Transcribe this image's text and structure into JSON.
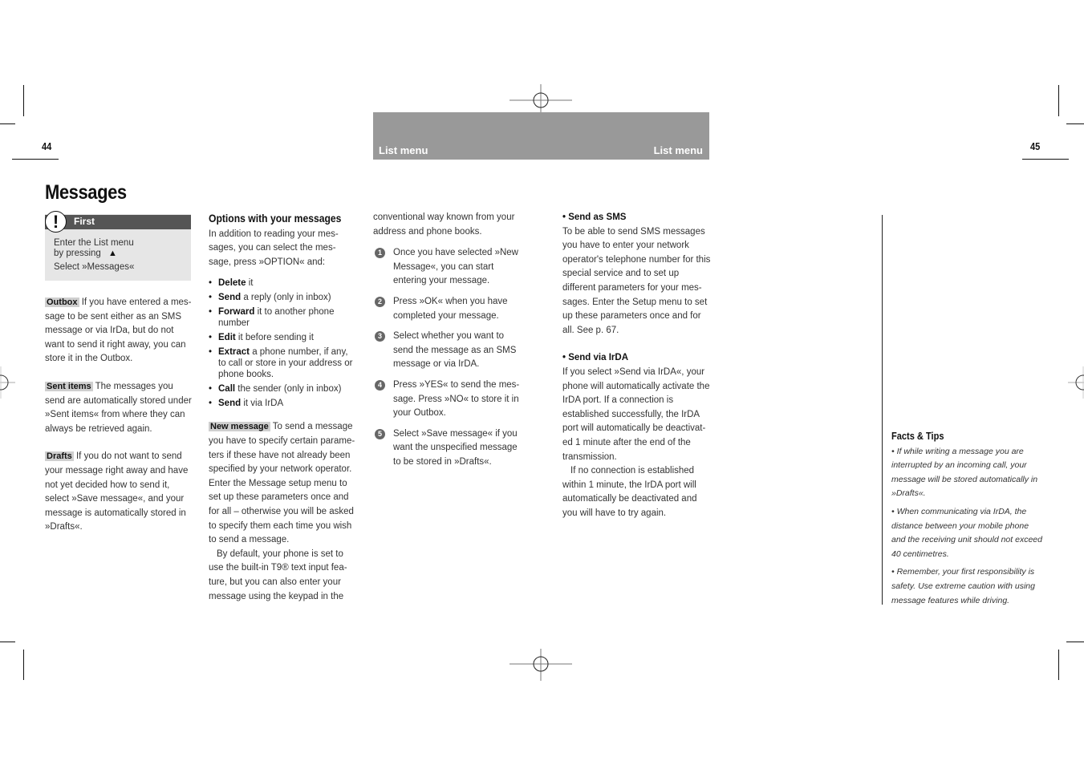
{
  "header": {
    "left_section": "List menu",
    "right_section": "List menu"
  },
  "page_numbers": {
    "left": "44",
    "right": "45"
  },
  "title": "Messages",
  "first_box": {
    "heading": "First",
    "icon": "exclamation-icon",
    "line1": "Enter the List menu",
    "line2": "by pressing",
    "key_icon": "▲",
    "line3": "Select »Messages«"
  },
  "left_column": {
    "outbox": {
      "tag": "Outbox",
      "text": " If you have entered a mes-sage to be sent either as an SMS message or via IrDa, but do not want to send it right away,  you can store it in the Outbox."
    },
    "sent_items": {
      "tag": "Sent items",
      "text": " The messages you send are automatically stored under »Sent items« from where they can always be retrieved again."
    },
    "drafts": {
      "tag": "Drafts",
      "text": " If you do not want to send your message right away and have not yet decided how to send it, select »Save message«, and your message is automatically stored in »Drafts«."
    }
  },
  "options_column": {
    "heading": "Options with your messages",
    "intro": "In addition to reading your mes-sages, you can select the mes-sage, press »OPTION« and:",
    "options": [
      {
        "bold": "Delete",
        "rest": " it"
      },
      {
        "bold": "Send",
        "rest": " a reply (only in inbox)"
      },
      {
        "bold": "Forward",
        "rest": " it to another phone number"
      },
      {
        "bold": "Edit",
        "rest": " it before sending it"
      },
      {
        "bold": "Extract",
        "rest": " a phone number, if any, to call or store in your address or phone books."
      },
      {
        "bold": "Call",
        "rest": " the sender (only in inbox)"
      },
      {
        "bold": "Send",
        "rest": " it via IrDA"
      }
    ],
    "new_message": {
      "tag": "New message",
      "text": " To send a message you have to specify certain parame-ters if these have not already been specified by your network operator. Enter the Message setup menu to set up these parameters once and for all – otherwise you will be asked to specify them each time you wish to send a message.",
      "text2": "By default, your phone is set to use the built-in T9® text input fea-ture, but you can also enter your message using the keypad in the"
    }
  },
  "steps_column": {
    "continuation": "conventional way known from your address and phone books.",
    "steps": [
      {
        "num": "1",
        "text": "Once you have selected »New Message«, you can start entering your message."
      },
      {
        "num": "2",
        "text": "Press »OK« when you have completed your message."
      },
      {
        "num": "3",
        "text": "Select whether you want to send the message as an SMS message or via IrDA."
      },
      {
        "num": "4",
        "text": "Press »YES« to send the mes-sage. Press »NO« to store it in your Outbox."
      },
      {
        "num": "5",
        "text": "Select »Save message« if you want the unspecified message to be stored in »Drafts«."
      }
    ]
  },
  "send_column": {
    "sms_heading": "• Send as SMS",
    "sms_text": "To be able to send SMS messages you have to enter your network operator's telephone number for this special service and to set up different parameters for your mes-sages. Enter the Setup menu to set up these parameters once and for all. See p. 67.",
    "irda_heading": "• Send via IrDA",
    "irda_text": "If you select »Send via IrDA«, your phone will automatically activate the IrDA port. If a connection is established successfully, the IrDA port will automatically be deactivat-ed 1 minute after the end of the transmission.",
    "irda_text2": "If no connection is established within 1 minute, the IrDA port will automatically be deactivated and you will have to try again."
  },
  "facts_tips": {
    "heading": "Facts & Tips",
    "tips": [
      "• If while writing a message you are interrupted by an incoming call, your message will be stored automatically in »Drafts«.",
      "• When communicating via IrDA, the distance between your mobile phone and the receiving unit should not exceed 40 centimetres.",
      "• Remember, your first responsibility is safety.  Use extreme caution with using message features while driving."
    ]
  },
  "colors": {
    "header_band": "#999999",
    "first_bar": "#555555",
    "first_box_bg": "#e6e6e6",
    "tag_bg": "#cfcfcf"
  }
}
